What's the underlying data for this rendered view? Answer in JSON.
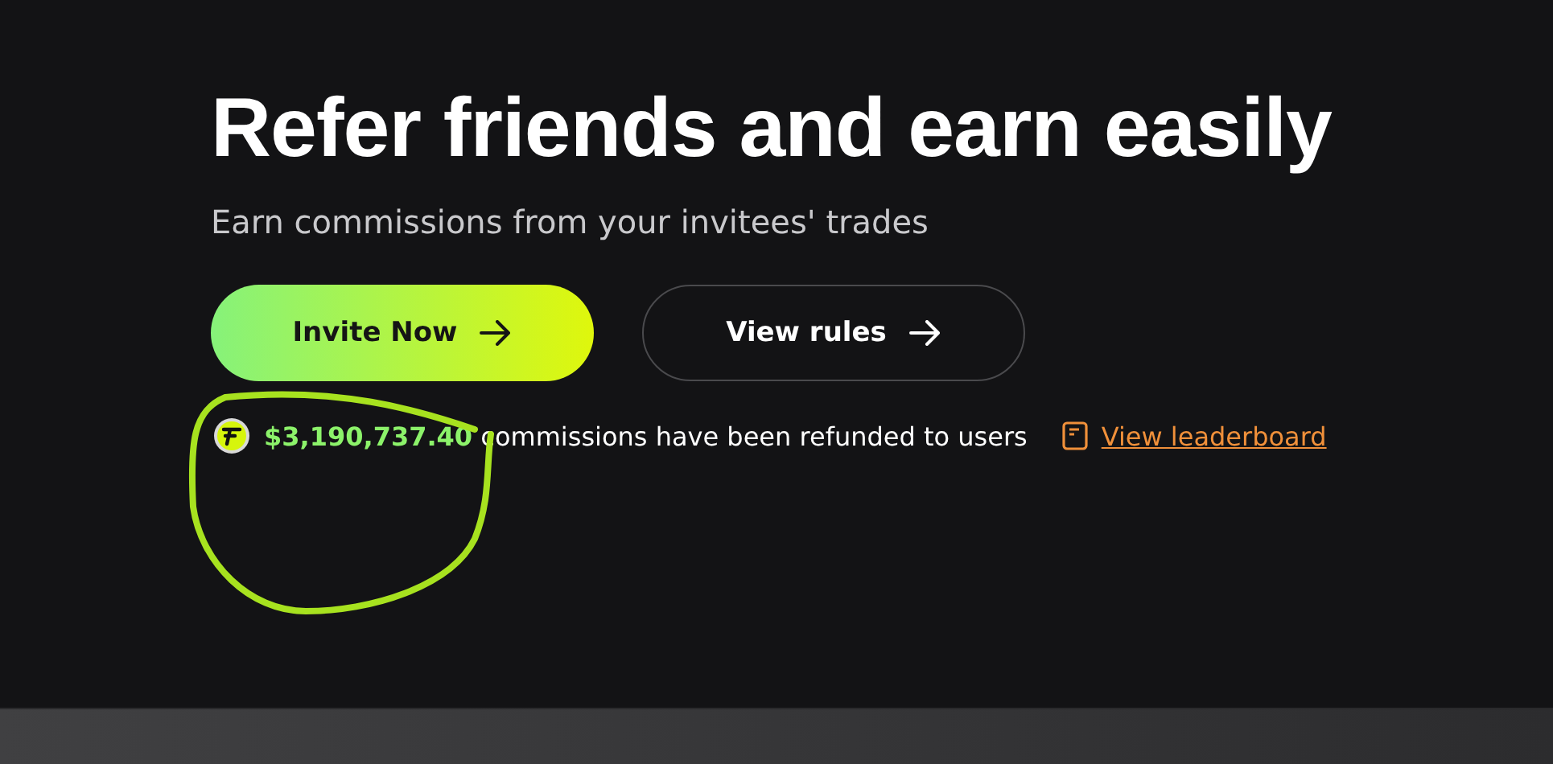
{
  "hero": {
    "title": "Refer friends and earn easily",
    "subtitle": "Earn commissions from your invitees' trades",
    "buttons": [
      {
        "label": "Invite Now",
        "kind": "primary"
      },
      {
        "label": "View rules",
        "kind": "secondary"
      }
    ],
    "stats": {
      "amount": "$3,190,737.40",
      "text": "commissions have been refunded to users"
    },
    "leaderboard_link": "View leaderboard"
  }
}
